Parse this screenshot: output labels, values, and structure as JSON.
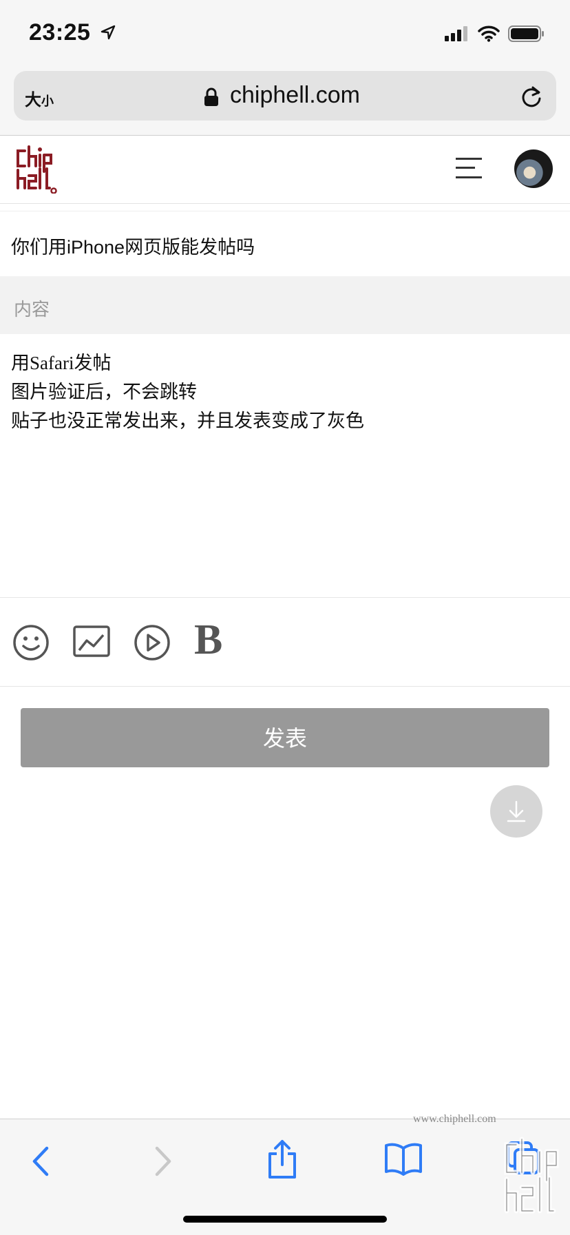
{
  "status_bar": {
    "time": "23:25"
  },
  "url_bar": {
    "text_size_big": "大",
    "text_size_small": "小",
    "domain": "chiphell.com"
  },
  "post": {
    "title": "你们用iPhone网页版能发帖吗",
    "content_placeholder": "内容",
    "body_lines": [
      "用Safari发帖",
      "图片验证后，不会跳转",
      "贴子也没正常发出来，并且发表变成了灰色"
    ]
  },
  "toolbar": {
    "bold_label": "B"
  },
  "submit": {
    "label": "发表"
  },
  "watermark": {
    "text": "www.chiphell.com"
  },
  "colors": {
    "accent": "#8b1c24",
    "button_disabled": "#999999",
    "ios_blue": "#2f7cf6"
  }
}
